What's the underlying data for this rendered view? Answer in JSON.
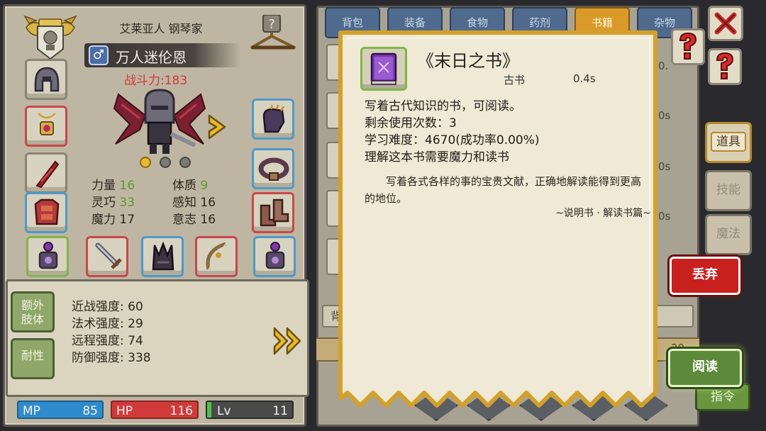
{
  "character": {
    "title": "艾莱亚人 钢琴家",
    "gender_symbol": "♂",
    "name": "万人迷伦恩",
    "combat_power": "战斗力:183",
    "stats": {
      "strength_label": "力量",
      "strength_value": "16",
      "constitution_label": "体质",
      "constitution_value": "9",
      "dexterity_label": "灵巧",
      "dexterity_value": "33",
      "perception_label": "感知",
      "perception_value": "16",
      "magic_label": "魔力",
      "magic_value": "17",
      "will_label": "意志",
      "will_value": "16"
    },
    "page_dots": 3,
    "active_dot": 0
  },
  "info_panel": {
    "tab_extra_limbs": "额外肢体",
    "tab_extra_limbs_line1": "额外",
    "tab_extra_limbs_line2": "肢体",
    "tab_resistance": "耐性",
    "melee": "近战强度: 60",
    "spell": "法术强度: 29",
    "ranged": "远程强度: 74",
    "defense": "防御强度: 338"
  },
  "bars": {
    "mp_label": "MP",
    "mp_value": "85",
    "hp_label": "HP",
    "hp_value": "116",
    "lv_label": "Lv",
    "lv_value": "11",
    "lv_progress": 0.05
  },
  "inventory": {
    "tabs": [
      "背包",
      "装备",
      "食物",
      "药剂",
      "书籍",
      "杂物"
    ],
    "active_tab": 4,
    "category_buttons": [
      "道具",
      "技能",
      "魔法"
    ],
    "active_category": 0,
    "discard_label": "丢弃",
    "read_label": "阅读",
    "command_label": "指令",
    "background_times": [
      "0.",
      "0s",
      "0s",
      "0s"
    ],
    "background_count": "20",
    "background_field_char": "背"
  },
  "tooltip": {
    "title": "《末日之书》",
    "item_type": "古书",
    "weight": "0.4s",
    "desc": [
      "写着古代知识的书，可阅读。",
      "剩余使用次数：3",
      "学习难度：4670(成功率0.00%)",
      "理解这本书需要魔力和读书"
    ],
    "flavor": "写着各式各样的事的宝贵文献，正确地解读能得到更高的地位。",
    "source": "~说明书 · 解读书篇~"
  },
  "colors": {
    "hp": "#d03a3a",
    "mp": "#2f8ccc",
    "stat_green": "#5f9b2a",
    "power_red": "#d23a3a",
    "active_tab": "#d99a2a",
    "discard": "#c8201e",
    "read": "#5c8a3a"
  }
}
